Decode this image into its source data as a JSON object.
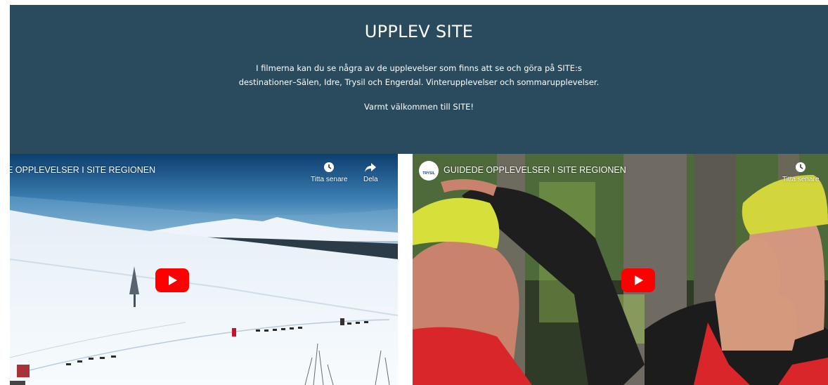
{
  "banner": {
    "title": "UPPLEV SITE",
    "intro_line1": "I filmerna kan du se några av de upplevelser som finns att se och göra på SITE:s",
    "intro_line2": "destinationer–Sälen, Idre, Trysil och Engerdal. Vinterupplevelser och sommarupplevelser.",
    "welcome": "Varmt välkommen till SITE!"
  },
  "video1": {
    "title": "E OPPLEVELSER I SITE REGIONEN",
    "watch_later": "Titta senare",
    "share": "Dela"
  },
  "video2": {
    "title": "GUIDEDE OPPLEVELSER I SITE REGIONEN",
    "channel": "TRYSIL",
    "watch_later": "Titta senare"
  },
  "colors": {
    "banner_bg": "#2a4a5e",
    "play_red": "#ff0000"
  }
}
